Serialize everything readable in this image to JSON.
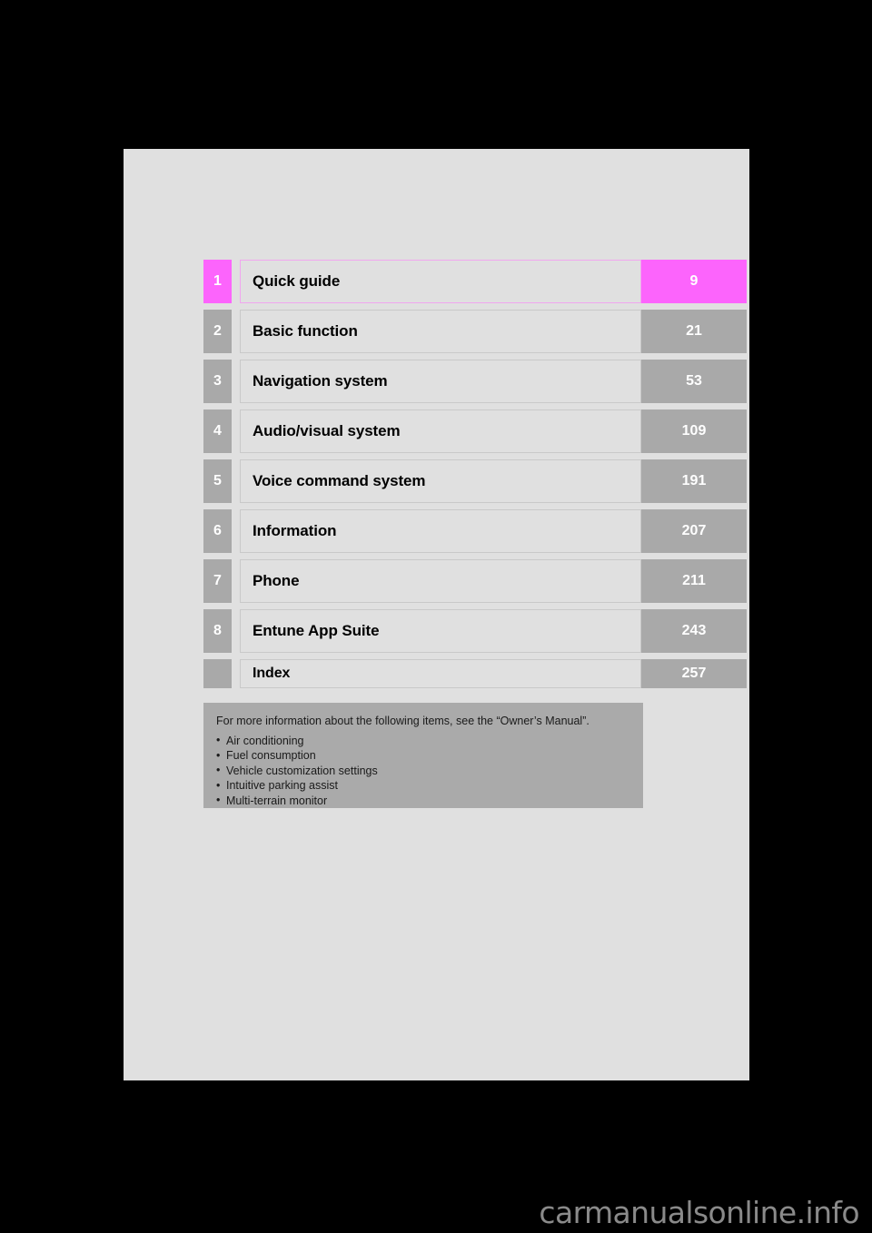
{
  "document": {
    "title": "Table of Contents",
    "page_background": "#e0e0e0",
    "canvas_background": "#000000",
    "accent_color": "#fc64fc",
    "neutral_color": "#a9a9a9"
  },
  "toc": {
    "rows": [
      {
        "number": "1",
        "label": "Quick guide",
        "page": "9",
        "highlight": true
      },
      {
        "number": "2",
        "label": "Basic function",
        "page": "21",
        "highlight": false
      },
      {
        "number": "3",
        "label": "Navigation system",
        "page": "53",
        "highlight": false
      },
      {
        "number": "4",
        "label": "Audio/visual system",
        "page": "109",
        "highlight": false
      },
      {
        "number": "5",
        "label": "Voice command system",
        "page": "191",
        "highlight": false
      },
      {
        "number": "6",
        "label": "Information",
        "page": "207",
        "highlight": false
      },
      {
        "number": "7",
        "label": "Phone",
        "page": "211",
        "highlight": false
      },
      {
        "number": "8",
        "label": "Entune App Suite",
        "page": "243",
        "highlight": false
      },
      {
        "number": "",
        "label": "Index",
        "page": "257",
        "highlight": false
      }
    ]
  },
  "notes": {
    "lead": "For more information about the following items, see the “Owner’s Manual”.",
    "items": [
      "Air conditioning",
      "Fuel consumption",
      "Vehicle customization settings",
      "Intuitive parking assist",
      "Multi-terrain monitor"
    ]
  },
  "watermark": {
    "text": "carmanualsonline.info"
  }
}
